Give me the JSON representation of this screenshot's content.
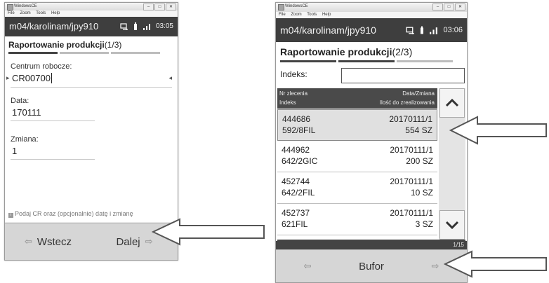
{
  "screen1": {
    "window_title": "WindowsCE",
    "menu": [
      "File",
      "Zoom",
      "Tools",
      "Help"
    ],
    "user": "m04/karolinam/jpy910",
    "time": "03:05",
    "heading": "Raportowanie produkcji",
    "step": "(1/3)",
    "work_center": {
      "label": "Centrum robocze:",
      "value": "CR00700"
    },
    "date": {
      "label": "Data:",
      "value": "170111"
    },
    "shift": {
      "label": "Zmiana:",
      "value": "1"
    },
    "hint": "Podaj CR oraz (opcjonalnie) datę i zmianę",
    "back_label": "Wstecz",
    "next_label": "Dalej"
  },
  "screen2": {
    "window_title": "WindowsCE",
    "menu": [
      "File",
      "Zoom",
      "Tools",
      "Help"
    ],
    "user": "m04/karolinam/jpy910",
    "time": "03:06",
    "heading": "Raportowanie produkcji",
    "step": "(2/3)",
    "index_label": "Indeks:",
    "index_value": "",
    "columns": {
      "order_no": "Nr zlecenia",
      "index": "Indeks",
      "date_shift": "Data/Zmiana",
      "qty": "Ilość do zrealizowania"
    },
    "rows": [
      {
        "order": "444686",
        "date": "20170111/1",
        "index": "592/8FIL",
        "qty": "554 SZ",
        "selected": true
      },
      {
        "order": "444962",
        "date": "20170111/1",
        "index": "642/2GIC",
        "qty": "200 SZ",
        "selected": false
      },
      {
        "order": "452744",
        "date": "20170111/1",
        "index": "642/2FIL",
        "qty": "10 SZ",
        "selected": false
      },
      {
        "order": "452737",
        "date": "20170111/1",
        "index": "621FIL",
        "qty": "3 SZ",
        "selected": false
      }
    ],
    "page_indicator": "1/15",
    "buffer_label": "Bufor"
  },
  "icons": {
    "sync": "sync-icon",
    "battery": "battery-icon",
    "signal": "signal-icon",
    "info": "info-icon",
    "back": "arrow-left-icon",
    "next": "arrow-right-icon",
    "scroll_up": "chevron-up-icon",
    "scroll_down": "chevron-down-icon"
  },
  "colors": {
    "status_bar": "#3e3e3e",
    "list_header": "#4a4a4a",
    "footer": "#d6d6d6",
    "callout_arrow": "#555555"
  }
}
